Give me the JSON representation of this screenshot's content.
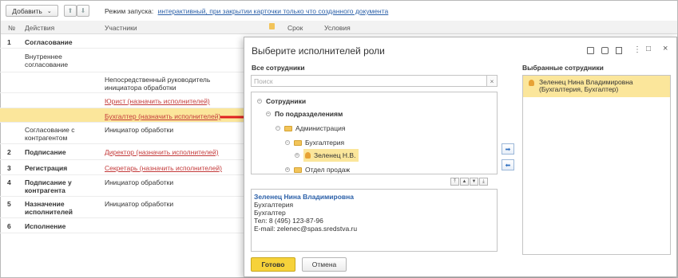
{
  "toolbar": {
    "add_label": "Добавить",
    "add_caret": "⌄",
    "up_arrow": "⬆",
    "down_arrow": "⬇",
    "mode_label": "Режим запуска:",
    "mode_value": "интерактивный, при закрытии карточки только что созданного документа"
  },
  "table": {
    "headers": {
      "num": "№",
      "actions": "Действия",
      "participants": "Участники",
      "deadline": "Срок",
      "conditions": "Условия"
    },
    "rows": [
      {
        "num": "1",
        "action": "Согласование",
        "participant": ""
      },
      {
        "num": "",
        "action": "Внутреннее согласование",
        "participant": ""
      },
      {
        "num": "",
        "action": "",
        "participant": "Непосредственный руководитель инициатора обработки"
      },
      {
        "num": "",
        "action": "",
        "participant": "Юрист (назначить исполнителей)"
      },
      {
        "num": "",
        "action": "",
        "participant": "Бухгалтер (назначить исполнителей)"
      },
      {
        "num": "",
        "action": "Согласование с контрагентом",
        "participant": "Инициатор обработки"
      },
      {
        "num": "2",
        "action": "Подписание",
        "participant": "Директор (назначить исполнителей)"
      },
      {
        "num": "3",
        "action": "Регистрация",
        "participant": "Секретарь (назначить исполнителей)"
      },
      {
        "num": "4",
        "action": "Подписание у контрагента",
        "participant": "Инициатор обработки"
      },
      {
        "num": "5",
        "action": "Назначение исполнителей",
        "participant": "Инициатор обработки"
      },
      {
        "num": "6",
        "action": "Исполнение",
        "participant": ""
      }
    ]
  },
  "dialog": {
    "title": "Выберите исполнителей роли",
    "all_employees_label": "Все сотрудники",
    "selected_employees_label": "Выбранные сотрудники",
    "search_placeholder": "Поиск",
    "search_clear": "×",
    "tree": {
      "root": "Сотрудники",
      "by_departments": "По подразделениям",
      "administration": "Администрация",
      "accounting": "Бухгалтерия",
      "employee": "Зеленец Н.В.",
      "sales": "Отдел продаж"
    },
    "selected": [
      "Зеленец Нина Владимировна (Бухгалтерия, Бухгалтер)"
    ],
    "details": {
      "name": "Зеленец Нина Владимировна",
      "department": "Бухгалтерия",
      "position": "Бухгалтер",
      "phone": "Тел: 8 (495) 123-87-96",
      "email": "E-mail: zelenec@spas.sredstva.ru"
    },
    "ok_label": "Готово",
    "cancel_label": "Отмена",
    "window_icons": [
      "⋮",
      "□",
      "×"
    ]
  },
  "colors": {
    "accent_yellow": "#fbe69b",
    "link_blue": "#2a5fa8",
    "link_red": "#c43b3b",
    "arrow_red": "#e02020",
    "ok_button": "#f6d23a"
  }
}
